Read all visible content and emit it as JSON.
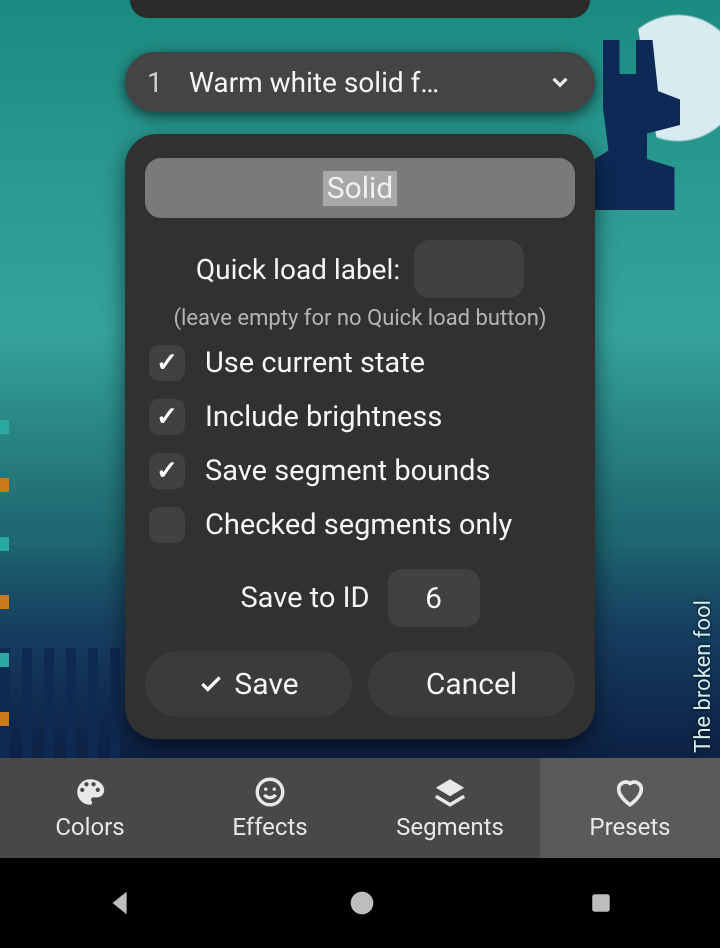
{
  "preset_selector": {
    "id": "1",
    "name": "Warm white solid f…"
  },
  "panel": {
    "name_value": "Solid",
    "quick_load_label": "Quick load label:",
    "quick_load_value": "",
    "hint": "(leave empty for no Quick load button)",
    "checks": [
      {
        "key": "use_state",
        "label": "Use current state",
        "checked": true
      },
      {
        "key": "include_bri",
        "label": "Include brightness",
        "checked": true
      },
      {
        "key": "save_bounds",
        "label": "Save segment bounds",
        "checked": true
      },
      {
        "key": "checked_only",
        "label": "Checked segments only",
        "checked": false
      }
    ],
    "save_to_id_label": "Save to ID",
    "save_to_id_value": "6",
    "save_button": "Save",
    "cancel_button": "Cancel"
  },
  "tabs": [
    {
      "key": "colors",
      "label": "Colors",
      "icon": "palette"
    },
    {
      "key": "effects",
      "label": "Effects",
      "icon": "smile"
    },
    {
      "key": "segments",
      "label": "Segments",
      "icon": "layers"
    },
    {
      "key": "presets",
      "label": "Presets",
      "icon": "heart"
    }
  ],
  "active_tab": "presets",
  "watermark": "The broken fool"
}
